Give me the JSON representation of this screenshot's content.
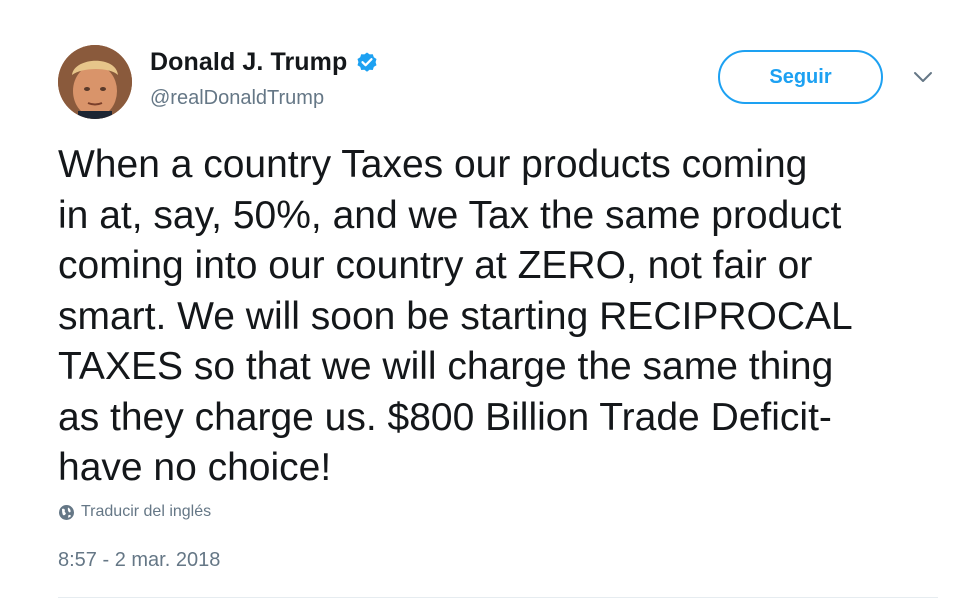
{
  "author": {
    "display_name": "Donald J. Trump",
    "handle": "@realDonaldTrump",
    "verified": true,
    "avatar_icon": "profile-photo-icon"
  },
  "actions": {
    "follow_label": "Seguir",
    "menu_icon": "chevron-down-icon"
  },
  "tweet": {
    "text": "When a country Taxes our products coming\nin at, say, 50%, and we Tax the same product\ncoming into our country at ZERO, not fair or\nsmart. We will soon be starting RECIPROCAL\nTAXES so that we will charge the same thing\nas they charge us. $800 Billion Trade Deficit-\nhave no choice!",
    "translate_label": "Traducir del inglés",
    "timestamp": "8:57 - 2 mar. 2018"
  },
  "colors": {
    "accent": "#1da1f2",
    "text": "#14171a",
    "secondary": "#657786"
  }
}
